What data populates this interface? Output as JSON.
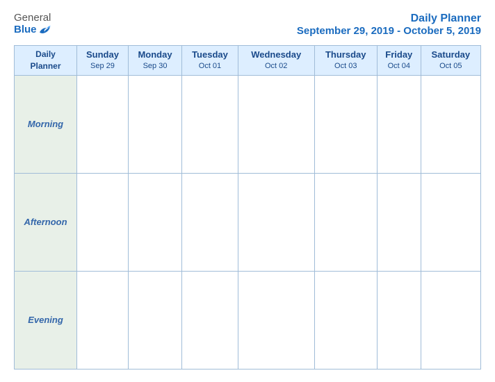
{
  "logo": {
    "general": "General",
    "blue": "Blue"
  },
  "header": {
    "title": "Daily Planner",
    "date_range": "September 29, 2019 - October 5, 2019"
  },
  "columns": [
    {
      "day": "Daily",
      "day2": "Planner",
      "date": ""
    },
    {
      "day": "Sunday",
      "date": "Sep 29"
    },
    {
      "day": "Monday",
      "date": "Sep 30"
    },
    {
      "day": "Tuesday",
      "date": "Oct 01"
    },
    {
      "day": "Wednesday",
      "date": "Oct 02"
    },
    {
      "day": "Thursday",
      "date": "Oct 03"
    },
    {
      "day": "Friday",
      "date": "Oct 04"
    },
    {
      "day": "Saturday",
      "date": "Oct 05"
    }
  ],
  "rows": [
    {
      "label": "Morning"
    },
    {
      "label": "Afternoon"
    },
    {
      "label": "Evening"
    }
  ]
}
